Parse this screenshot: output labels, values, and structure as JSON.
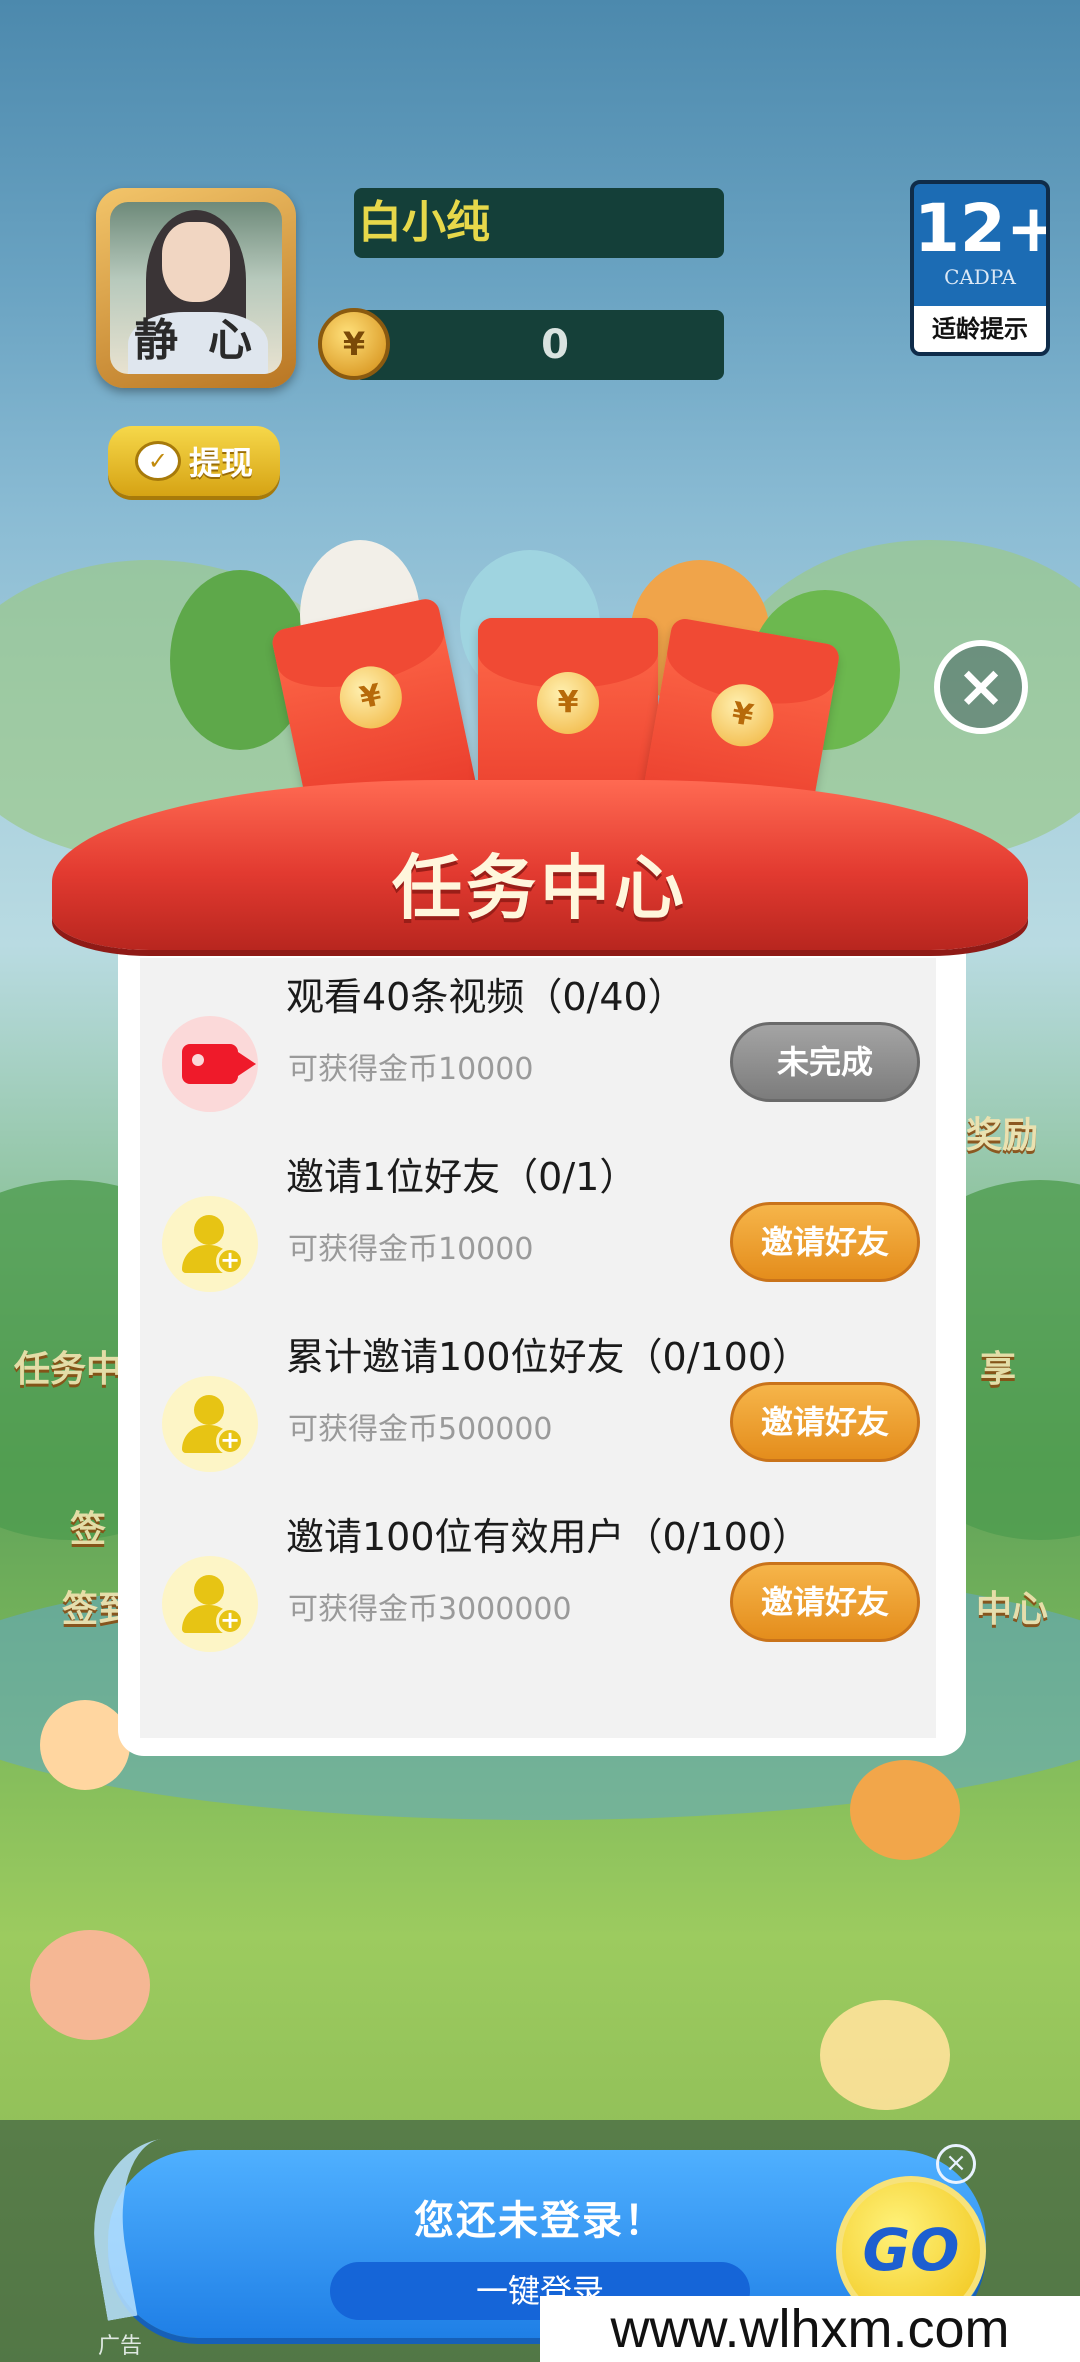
{
  "profile": {
    "avatar_caption": "静心",
    "name": "白小纯",
    "coin_symbol": "¥",
    "coin_balance": "0",
    "withdraw_label": "提现"
  },
  "age_rating": {
    "number": "12+",
    "org": "CADPA",
    "tip": "适龄提示"
  },
  "background_labels": {
    "left_1": "任务中",
    "left_2": "签",
    "left_3": "签到",
    "right_1": "奖励",
    "right_2": "享",
    "right_3": "中心"
  },
  "modal": {
    "title": "任务中心",
    "close_icon": "close-icon",
    "packet_symbol": "¥",
    "tasks": [
      {
        "icon": "video-camera-icon",
        "title": "观看40条视频（0/40）",
        "reward": "可获得金币10000",
        "button": "未完成",
        "status": "incomplete"
      },
      {
        "icon": "add-user-icon",
        "title": "邀请1位好友（0/1）",
        "reward": "可获得金币10000",
        "button": "邀请好友",
        "status": "invite"
      },
      {
        "icon": "add-user-icon",
        "title": "累计邀请100位好友（0/100）",
        "reward": "可获得金币500000",
        "button": "邀请好友",
        "status": "invite"
      },
      {
        "icon": "add-user-icon",
        "title": "邀请100位有效用户（0/100）",
        "reward": "可获得金币3000000",
        "button": "邀请好友",
        "status": "invite"
      }
    ]
  },
  "login_ad": {
    "title": "您还未登录！",
    "button": "一键登录",
    "go": "GO",
    "ad_tag": "广告",
    "close_glyph": "×"
  },
  "watermark": "www.wlhxm.com",
  "colors": {
    "invite_button": "#e48d1c",
    "incomplete_button": "#7c7c7c",
    "ribbon": "#e23a30",
    "login_banner": "#1f7fe6"
  }
}
